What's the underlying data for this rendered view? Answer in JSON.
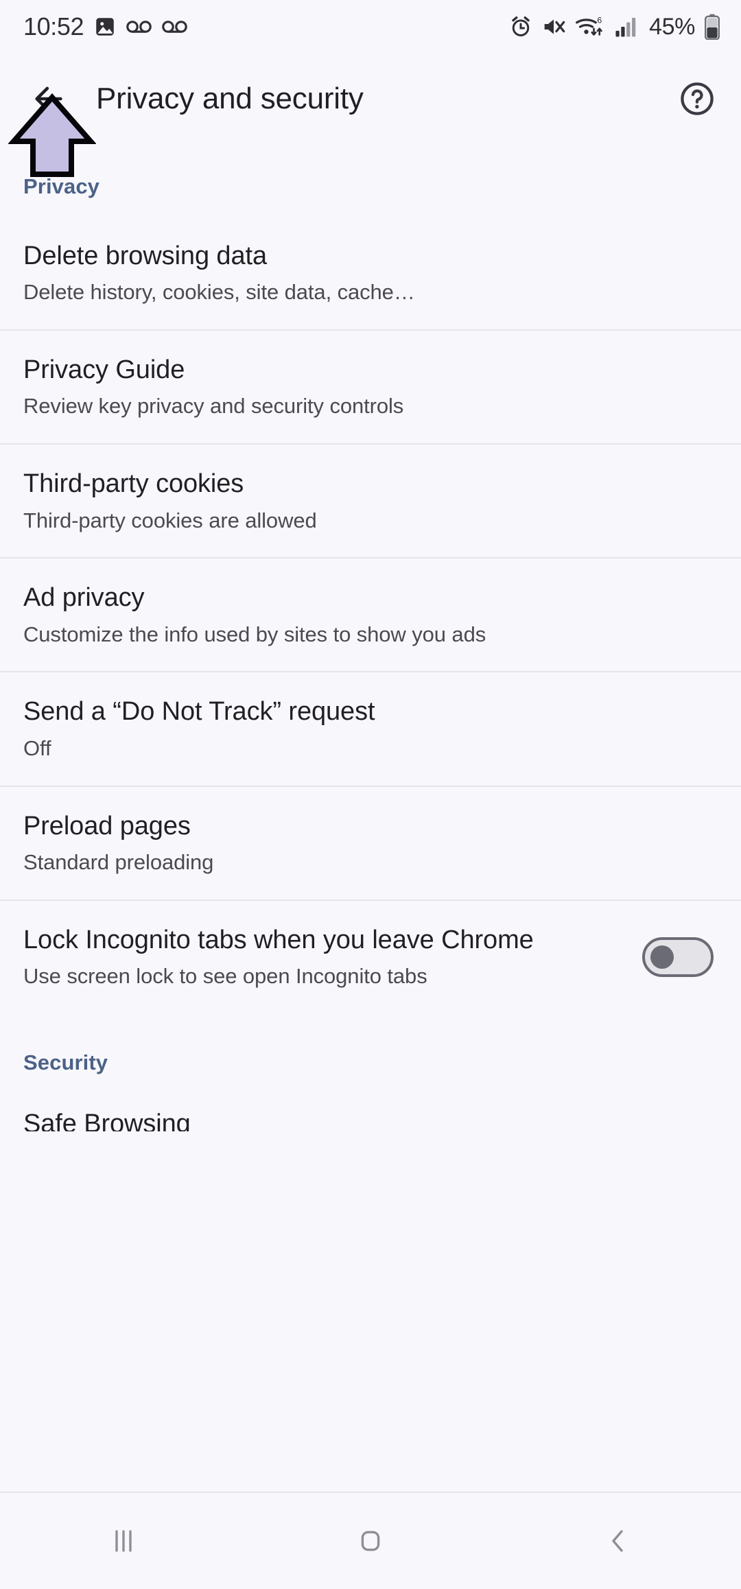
{
  "status_bar": {
    "time": "10:52",
    "battery_percent": "45%",
    "left_icons": [
      "photo-icon",
      "voicemail-icon",
      "voicemail-icon"
    ],
    "right_icons": [
      "alarm-icon",
      "mute-icon",
      "wifi-6-icon",
      "signal-icon",
      "battery-icon"
    ]
  },
  "app_bar": {
    "title": "Privacy and security",
    "back_icon": "back-arrow-icon",
    "help_icon": "help-circle-icon"
  },
  "sections": {
    "privacy_header": "Privacy",
    "security_header": "Security"
  },
  "rows": [
    {
      "title": "Delete browsing data",
      "subtitle": "Delete history, cookies, site data, cache…"
    },
    {
      "title": "Privacy Guide",
      "subtitle": "Review key privacy and security controls"
    },
    {
      "title": "Third-party cookies",
      "subtitle": "Third-party cookies are allowed"
    },
    {
      "title": "Ad privacy",
      "subtitle": "Customize the info used by sites to show you ads"
    },
    {
      "title": "Send a “Do Not Track” request",
      "subtitle": "Off"
    },
    {
      "title": "Preload pages",
      "subtitle": "Standard preloading"
    },
    {
      "title": "Lock Incognito tabs when you leave Chrome",
      "subtitle": "Use screen lock to see open Incognito tabs",
      "toggle": "off"
    }
  ],
  "security_rows": [
    {
      "title": "Safe Browsing"
    }
  ],
  "nav_bar": {
    "recents_icon": "recents-icon",
    "home_icon": "home-icon",
    "back_icon": "nav-back-icon"
  },
  "annotation": {
    "arrow_icon": "annotation-up-arrow",
    "fill": "#c5bfe4",
    "stroke": "#000000"
  },
  "colors": {
    "background": "#f8f8fc",
    "section_header": "#4c6287",
    "title": "#1f1f24",
    "subtitle": "#4a4a50",
    "divider": "#e4e4ea"
  }
}
